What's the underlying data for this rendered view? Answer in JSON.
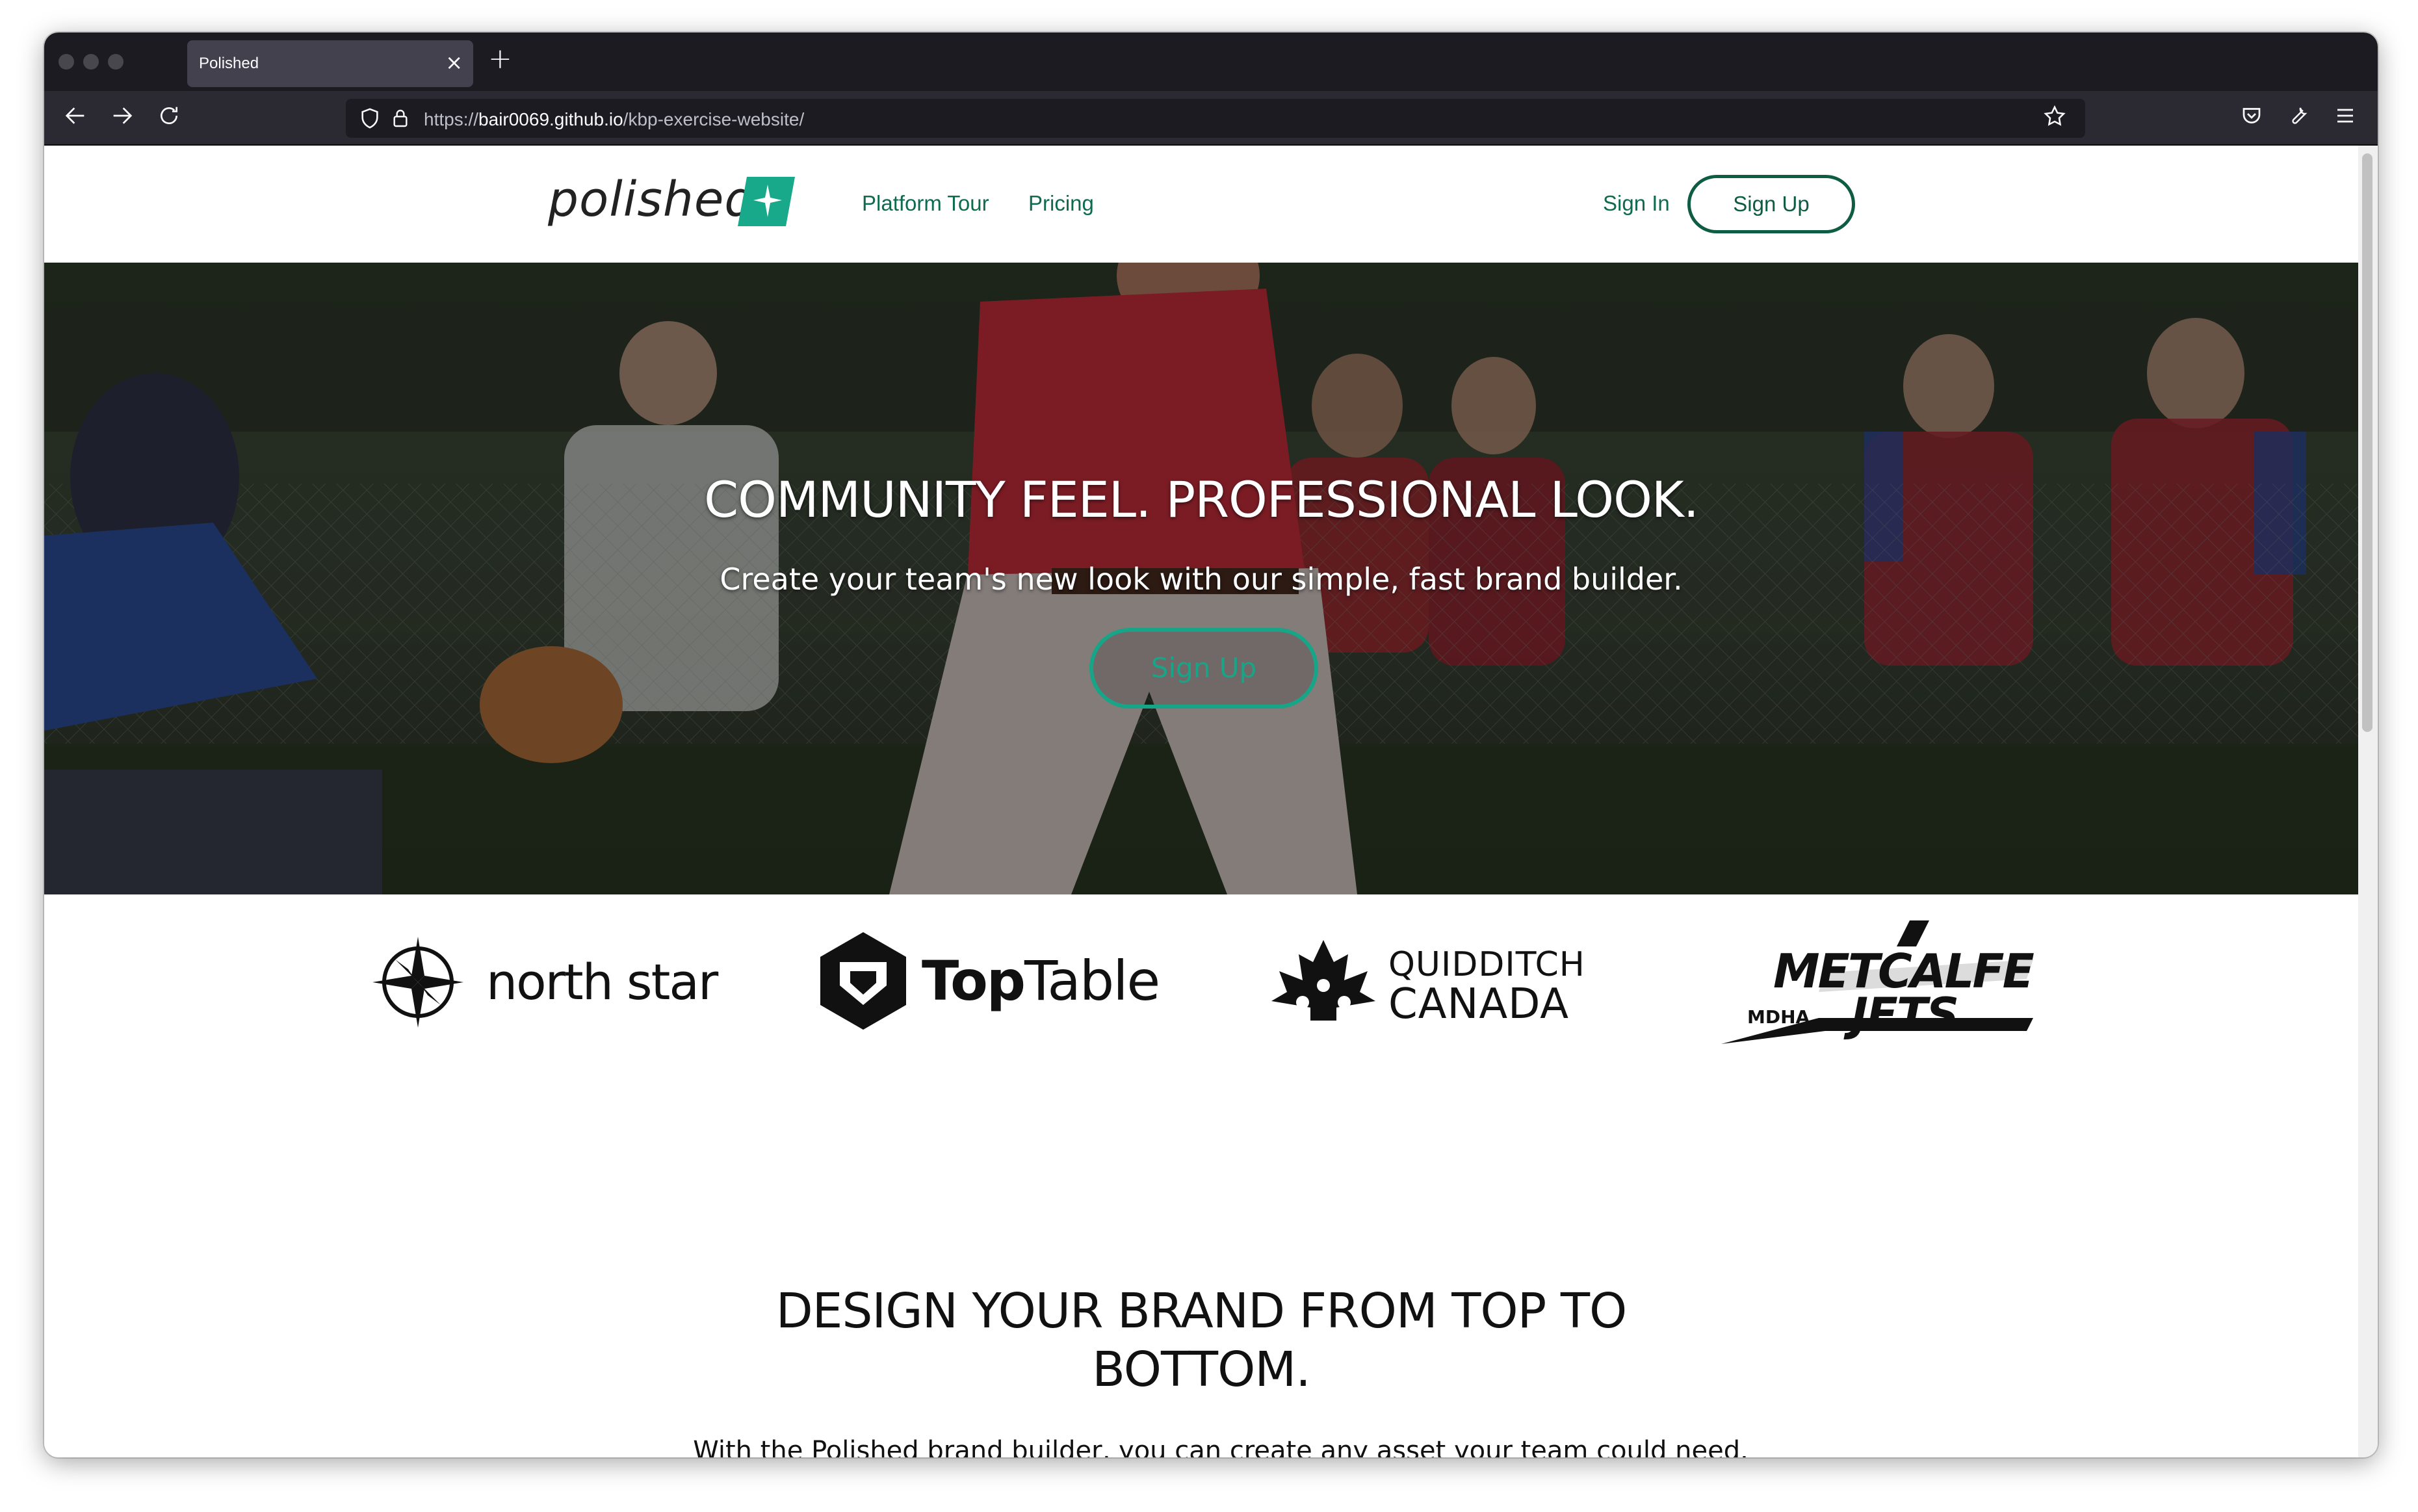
{
  "browser": {
    "tab_title": "Polished",
    "tab_close": "×",
    "new_tab": "+",
    "url_scheme": "https://",
    "url_host": "bair0069.github.io",
    "url_path": "/kbp-exercise-website/"
  },
  "site": {
    "logo_text": "polished",
    "nav": {
      "platform_tour": "Platform Tour",
      "pricing": "Pricing",
      "sign_in": "Sign In",
      "sign_up": "Sign Up"
    },
    "hero": {
      "title": "COMMUNITY FEEL. PROFESSIONAL LOOK.",
      "subtitle": "Create your team's new look with our simple, fast brand builder.",
      "cta": "Sign Up"
    },
    "clients": {
      "north_star": "north star",
      "top": "Top",
      "table": "Table",
      "quidditch": "QUIDDITCH",
      "canada": "CANADA",
      "metcalfe": "METCALFE",
      "jets": "JETS",
      "mdha": "MDHA"
    },
    "brand": {
      "heading": "DESIGN YOUR BRAND FROM TOP TO BOTTOM.",
      "body": "With the Polished brand builder, you can create any asset your team could need. From logos to jerseys, to merchandise, to advertisements. With simple templates, a variety of pre-"
    }
  },
  "colors": {
    "accent_green": "#0f6b4f",
    "cta_teal": "#18a587",
    "browser_dark": "#1c1b22"
  }
}
